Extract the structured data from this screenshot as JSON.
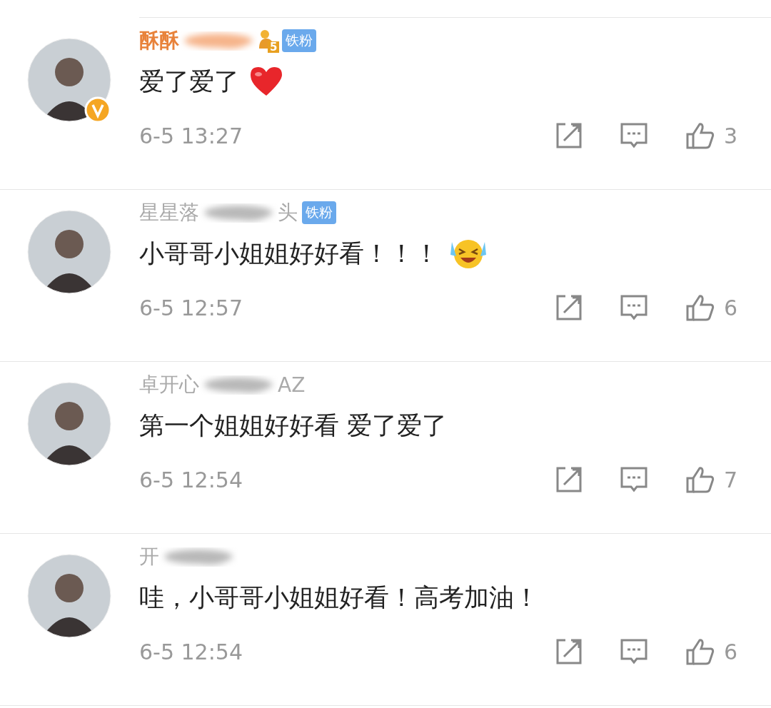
{
  "comments": [
    {
      "name_parts": [
        "酥酥"
      ],
      "vip": true,
      "level": "5",
      "fan_badge": "铁粉",
      "verified": true,
      "text": "爱了爱了",
      "emoji": {
        "kind": "heart"
      },
      "time": "6-5 13:27",
      "likes": "3"
    },
    {
      "name_parts": [
        "星星落",
        "头"
      ],
      "vip": false,
      "fan_badge": "铁粉",
      "verified": false,
      "text": "小哥哥小姐姐好好看！！！",
      "emoji": {
        "kind": "laugh-cry"
      },
      "time": "6-5 12:57",
      "likes": "6"
    },
    {
      "name_parts": [
        "卓开心",
        "AZ"
      ],
      "vip": false,
      "verified": false,
      "text": "第一个姐姐好好看 爱了爱了",
      "time": "6-5 12:54",
      "likes": "7"
    },
    {
      "name_parts": [
        "开"
      ],
      "vip": false,
      "verified": false,
      "text": "哇，小哥哥小姐姐好看！高考加油！",
      "time": "6-5 12:54",
      "likes": "6"
    }
  ]
}
